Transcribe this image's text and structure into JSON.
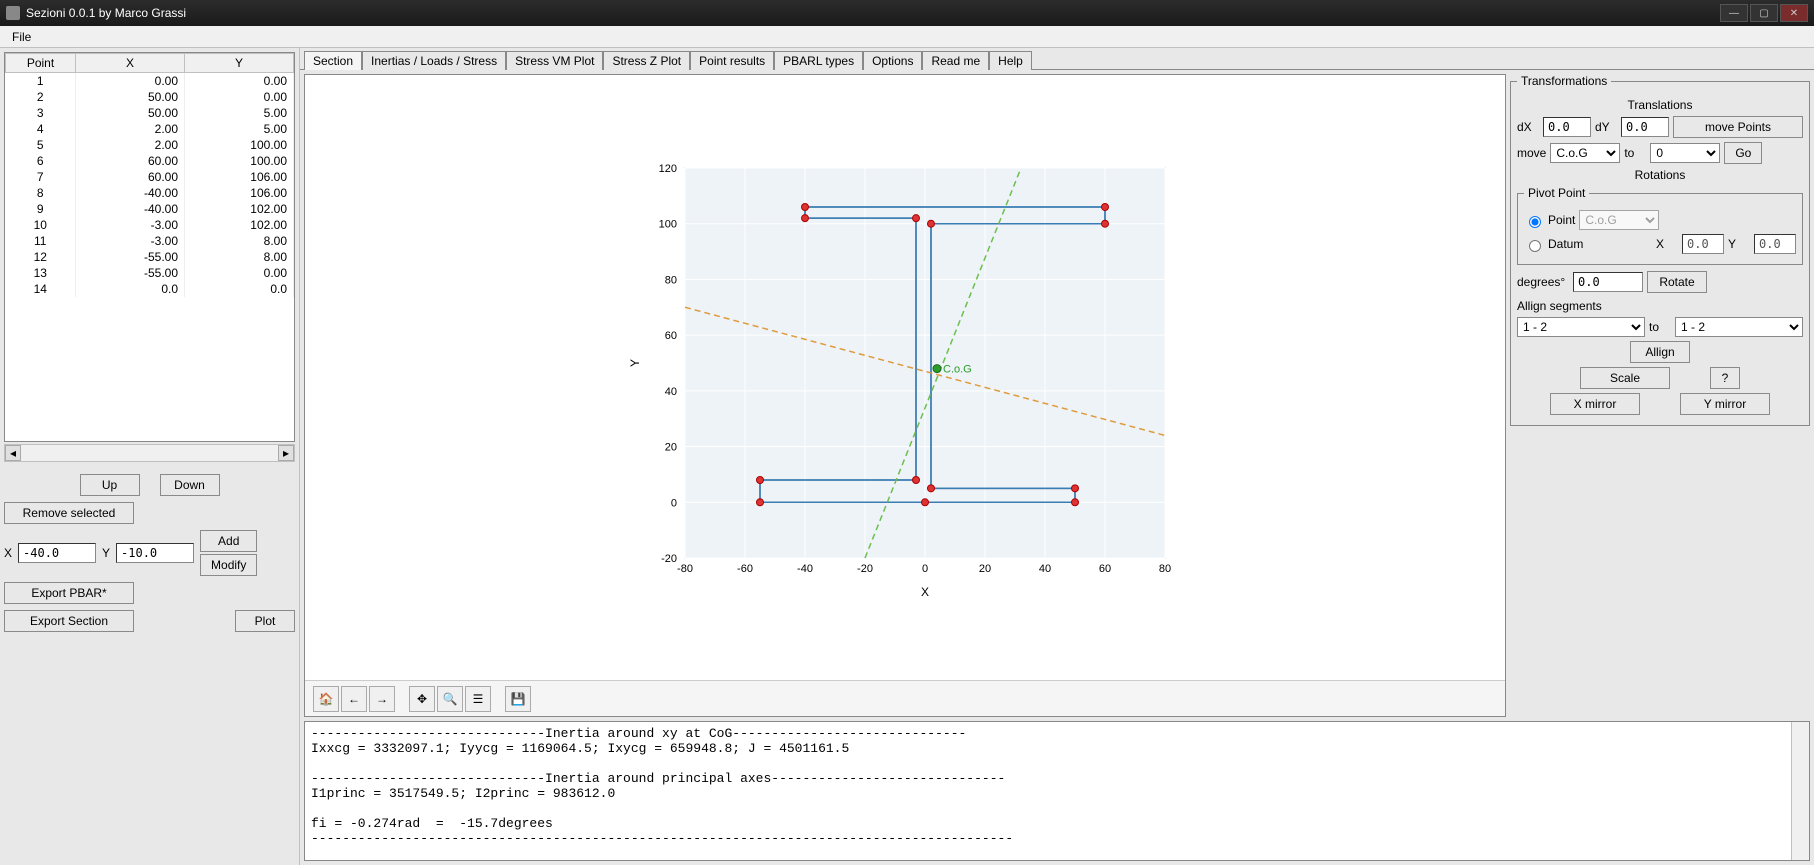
{
  "window": {
    "title": "Sezioni 0.0.1 by Marco Grassi"
  },
  "menu": {
    "file": "File"
  },
  "points_table": {
    "headers": [
      "Point",
      "X",
      "Y"
    ],
    "rows": [
      {
        "n": "1",
        "x": "0.00",
        "y": "0.00"
      },
      {
        "n": "2",
        "x": "50.00",
        "y": "0.00"
      },
      {
        "n": "3",
        "x": "50.00",
        "y": "5.00"
      },
      {
        "n": "4",
        "x": "2.00",
        "y": "5.00"
      },
      {
        "n": "5",
        "x": "2.00",
        "y": "100.00"
      },
      {
        "n": "6",
        "x": "60.00",
        "y": "100.00"
      },
      {
        "n": "7",
        "x": "60.00",
        "y": "106.00"
      },
      {
        "n": "8",
        "x": "-40.00",
        "y": "106.00"
      },
      {
        "n": "9",
        "x": "-40.00",
        "y": "102.00"
      },
      {
        "n": "10",
        "x": "-3.00",
        "y": "102.00"
      },
      {
        "n": "11",
        "x": "-3.00",
        "y": "8.00"
      },
      {
        "n": "12",
        "x": "-55.00",
        "y": "8.00"
      },
      {
        "n": "13",
        "x": "-55.00",
        "y": "0.00"
      },
      {
        "n": "14",
        "x": "0.0",
        "y": "0.0"
      }
    ]
  },
  "left_buttons": {
    "up": "Up",
    "down": "Down",
    "remove": "Remove selected",
    "x_label": "X",
    "x_val": "-40.0",
    "y_label": "Y",
    "y_val": "-10.0",
    "add": "Add",
    "modify": "Modify",
    "export_pbar": "Export PBAR*",
    "export_section": "Export Section",
    "plot": "Plot"
  },
  "tabs": [
    "Section",
    "Inertias / Loads / Stress",
    "Stress VM Plot",
    "Stress Z Plot",
    "Point results",
    "PBARL types",
    "Options",
    "Read me",
    "Help"
  ],
  "active_tab": "Section",
  "plot": {
    "x_label": "X",
    "y_label": "Y",
    "cog_label": "C.o.G",
    "y_ticks": [
      "120",
      "100",
      "80",
      "60",
      "40",
      "20",
      "0",
      "-20"
    ],
    "x_ticks": [
      "-80",
      "-60",
      "-40",
      "-20",
      "0",
      "20",
      "40",
      "60",
      "80"
    ]
  },
  "chart_data": {
    "type": "line",
    "title": "",
    "xlabel": "X",
    "ylabel": "Y",
    "xlim": [
      -80,
      80
    ],
    "ylim": [
      -20,
      120
    ],
    "series": [
      {
        "name": "Section2",
        "color": "#3b7db3",
        "points": [
          [
            -55,
            0
          ],
          [
            -55,
            8
          ],
          [
            -3,
            8
          ],
          [
            -3,
            102
          ],
          [
            -40,
            102
          ],
          [
            -40,
            106
          ],
          [
            60,
            106
          ],
          [
            60,
            100
          ],
          [
            2,
            100
          ],
          [
            2,
            5
          ],
          [
            50,
            5
          ],
          [
            50,
            0
          ],
          [
            -55,
            0
          ]
        ]
      },
      {
        "name": "Section1",
        "color": "#3b7db3",
        "points": [
          [
            0,
            0
          ],
          [
            50,
            0
          ],
          [
            50,
            5
          ],
          [
            2,
            5
          ],
          [
            2,
            100
          ],
          [
            60,
            100
          ],
          [
            60,
            106
          ],
          [
            -40,
            106
          ],
          [
            -40,
            102
          ],
          [
            -3,
            102
          ],
          [
            -3,
            8
          ],
          [
            -55,
            8
          ],
          [
            -55,
            0
          ],
          [
            0,
            0
          ]
        ]
      },
      {
        "name": "PrincipalAxis1",
        "style": "dashed",
        "color": "#e09a3e",
        "points": [
          [
            -80,
            70
          ],
          [
            80,
            24
          ]
        ]
      },
      {
        "name": "PrincipalAxis2",
        "style": "dashed",
        "color": "#6cbf4e",
        "points": [
          [
            -20,
            -20
          ],
          [
            32,
            120
          ]
        ]
      }
    ],
    "markers": [
      {
        "x": 0,
        "y": 0
      },
      {
        "x": 50,
        "y": 0
      },
      {
        "x": 50,
        "y": 5
      },
      {
        "x": 2,
        "y": 5
      },
      {
        "x": 2,
        "y": 100
      },
      {
        "x": 60,
        "y": 100
      },
      {
        "x": 60,
        "y": 106
      },
      {
        "x": -40,
        "y": 106
      },
      {
        "x": -40,
        "y": 102
      },
      {
        "x": -3,
        "y": 102
      },
      {
        "x": -3,
        "y": 8
      },
      {
        "x": -55,
        "y": 8
      },
      {
        "x": -55,
        "y": 0
      }
    ],
    "cog": {
      "x": 4,
      "y": 48
    }
  },
  "transform": {
    "panel_title": "Transformations",
    "translations": "Translations",
    "dX": "dX",
    "dX_val": "0.0",
    "dY": "dY",
    "dY_val": "0.0",
    "move_points": "move Points",
    "move": "move",
    "move_sel": "C.o.G",
    "to": "to",
    "to_sel": "0",
    "go": "Go",
    "rotations": "Rotations",
    "pivot": "Pivot Point",
    "point": "Point",
    "point_sel": "C.o.G",
    "datum": "Datum",
    "datum_x": "X",
    "datum_x_val": "0.0",
    "datum_y": "Y",
    "datum_y_val": "0.0",
    "degrees": "degrees°",
    "degrees_val": "0.0",
    "rotate": "Rotate",
    "align": "Allign segments",
    "seg1": "1 - 2",
    "seg_to": "to",
    "seg2": "1 - 2",
    "align_btn": "Allign",
    "scale": "Scale",
    "help": "?",
    "xmirror": "X mirror",
    "ymirror": "Y mirror"
  },
  "log": "------------------------------Inertia around xy at CoG------------------------------\nIxxcg = 3332097.1; Iyycg = 1169064.5; Ixycg = 659948.8; J = 4501161.5\n\n------------------------------Inertia around principal axes------------------------------\nI1princ = 3517549.5; I2princ = 983612.0\n\nfi = -0.274rad  =  -15.7degrees\n------------------------------------------------------------------------------------------"
}
